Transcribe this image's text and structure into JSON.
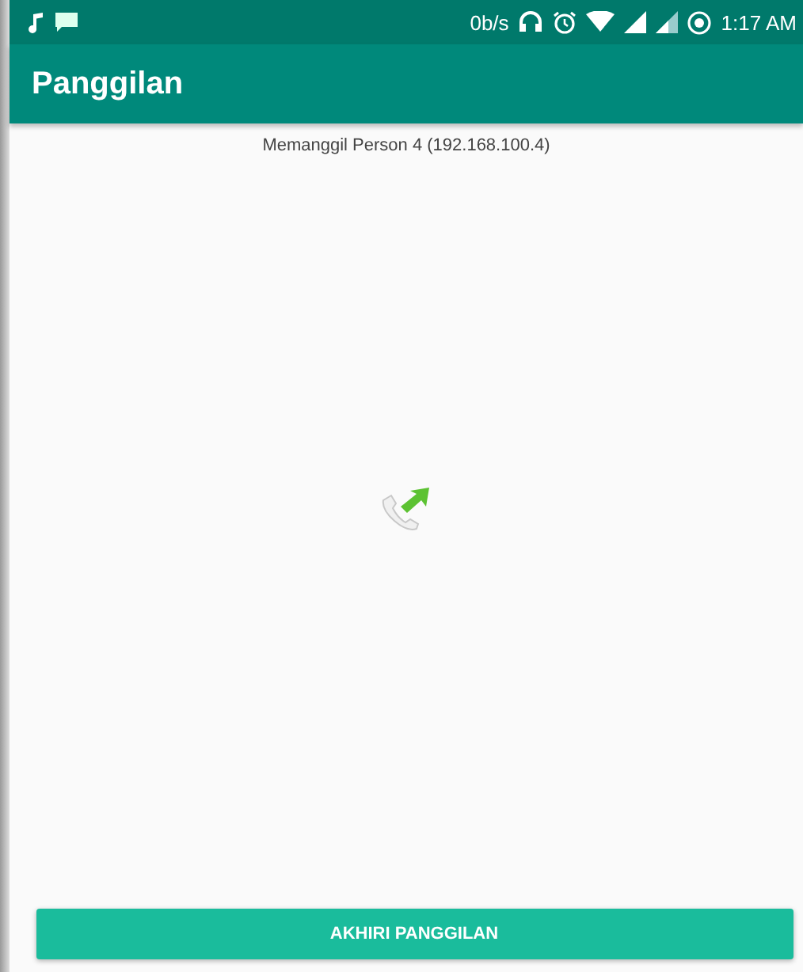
{
  "status_bar": {
    "speed": "0b/s",
    "time": "1:17 AM"
  },
  "app_bar": {
    "title": "Panggilan"
  },
  "call": {
    "status_text": "Memanggil Person 4 (192.168.100.4)"
  },
  "buttons": [
    {
      "label": "AKHIRI PANGGILAN"
    }
  ]
}
